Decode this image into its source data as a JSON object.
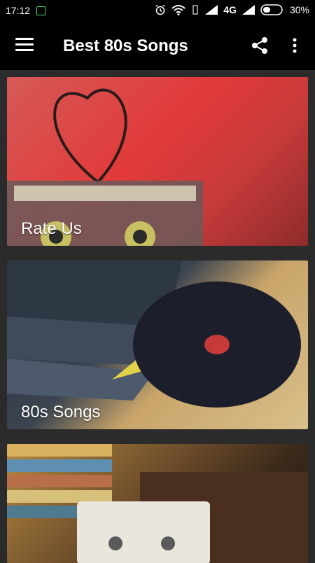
{
  "status_bar": {
    "time": "17:12",
    "network": "4G",
    "battery": "30%"
  },
  "toolbar": {
    "title": "Best 80s Songs"
  },
  "cards": [
    {
      "label": "Rate Us",
      "image": "cassette-heart-image"
    },
    {
      "label": "80s Songs",
      "image": "vinyl-records-image"
    },
    {
      "label": "",
      "image": "cassette-tapes-image"
    }
  ],
  "colors": {
    "background": "#2b2b2b",
    "toolbar": "#000000"
  }
}
